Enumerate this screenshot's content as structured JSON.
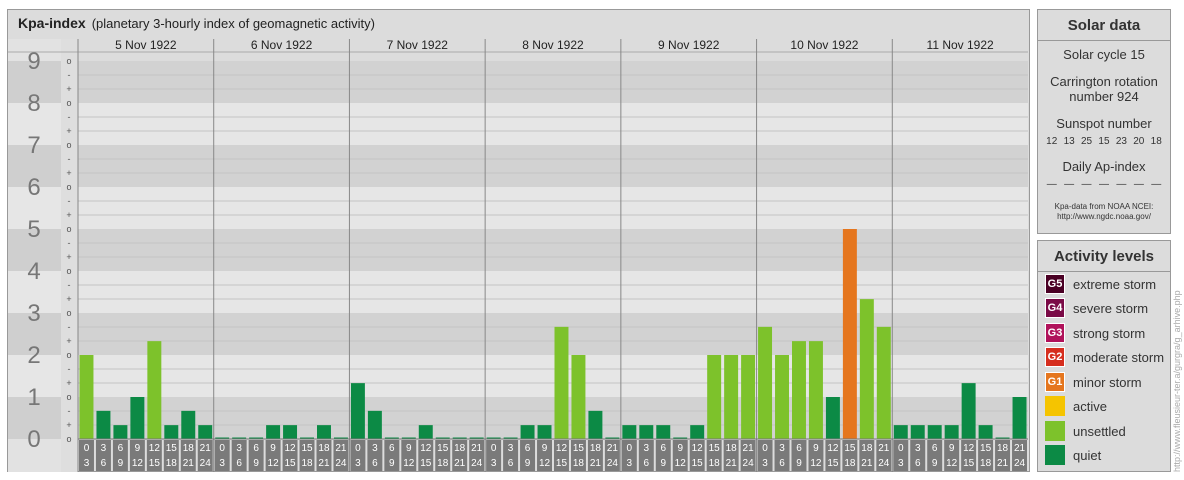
{
  "header": {
    "title": "Kpa-index",
    "subtitle": "(planetary 3-hourly index of geomagnetic activity)"
  },
  "chart_data": {
    "type": "bar",
    "title": "Kpa-index",
    "subtitle": "(planetary 3-hourly index of geomagnetic activity)",
    "ylim": [
      0,
      9
    ],
    "y_ticks": [
      "0",
      "1",
      "2",
      "3",
      "4",
      "5",
      "6",
      "7",
      "8",
      "9"
    ],
    "y_subticks": [
      "-",
      "o",
      "+"
    ],
    "days": [
      "5 Nov 1922",
      "6 Nov 1922",
      "7 Nov 1922",
      "8 Nov 1922",
      "9 Nov 1922",
      "10 Nov 1922",
      "11 Nov 1922"
    ],
    "interval_start": [
      "0",
      "3",
      "6",
      "9",
      "12",
      "15",
      "18",
      "21"
    ],
    "interval_end": [
      "3",
      "6",
      "9",
      "12",
      "15",
      "18",
      "21",
      "24"
    ],
    "values": [
      [
        2.0,
        0.67,
        0.33,
        1.0,
        2.33,
        0.33,
        0.67,
        0.33
      ],
      [
        0,
        0,
        0,
        0.33,
        0.33,
        0,
        0.33,
        0
      ],
      [
        1.33,
        0.67,
        0,
        0,
        0.33,
        0,
        0,
        0
      ],
      [
        0,
        0,
        0.33,
        0.33,
        2.67,
        2.0,
        0.67,
        0
      ],
      [
        0.33,
        0.33,
        0.33,
        0,
        0.33,
        2.0,
        2.0,
        2.0
      ],
      [
        2.67,
        2.0,
        2.33,
        2.33,
        1.0,
        5.0,
        3.33,
        2.67
      ],
      [
        0.33,
        0.33,
        0.33,
        0.33,
        1.33,
        0.33,
        0,
        1.0
      ]
    ],
    "grid": true,
    "legend": "right"
  },
  "solar": {
    "title": "Solar data",
    "cycle": "Solar cycle 15",
    "carrington_line1": "Carrington rotation",
    "carrington_line2": "number 924",
    "sunspot_label": "Sunspot number",
    "sunspot_values": [
      "12",
      "13",
      "25",
      "15",
      "23",
      "20",
      "18"
    ],
    "ap_label": "Daily Ap-index",
    "ap_values": [
      "—",
      "—",
      "—",
      "—",
      "—",
      "—",
      "—"
    ],
    "source_line1": "Kpa-data from NOAA NCEI:",
    "source_line2": "http://www.ngdc.noaa.gov/"
  },
  "activity": {
    "title": "Activity levels",
    "items": [
      {
        "badge": "G5",
        "label": "extreme storm",
        "color": "#4a0024"
      },
      {
        "badge": "G4",
        "label": "severe storm",
        "color": "#7a0a46"
      },
      {
        "badge": "G3",
        "label": "strong storm",
        "color": "#b0125a"
      },
      {
        "badge": "G2",
        "label": "moderate storm",
        "color": "#d62e1e"
      },
      {
        "badge": "G1",
        "label": "minor storm",
        "color": "#e5761e"
      },
      {
        "badge": "",
        "label": "active",
        "color": "#f5c400"
      },
      {
        "badge": "",
        "label": "unsettled",
        "color": "#7dc22b"
      },
      {
        "badge": "",
        "label": "quiet",
        "color": "#0c8a45"
      }
    ]
  },
  "watermark": "http://www.fleusieur-ter.a/gurgra/g_arhive.php"
}
